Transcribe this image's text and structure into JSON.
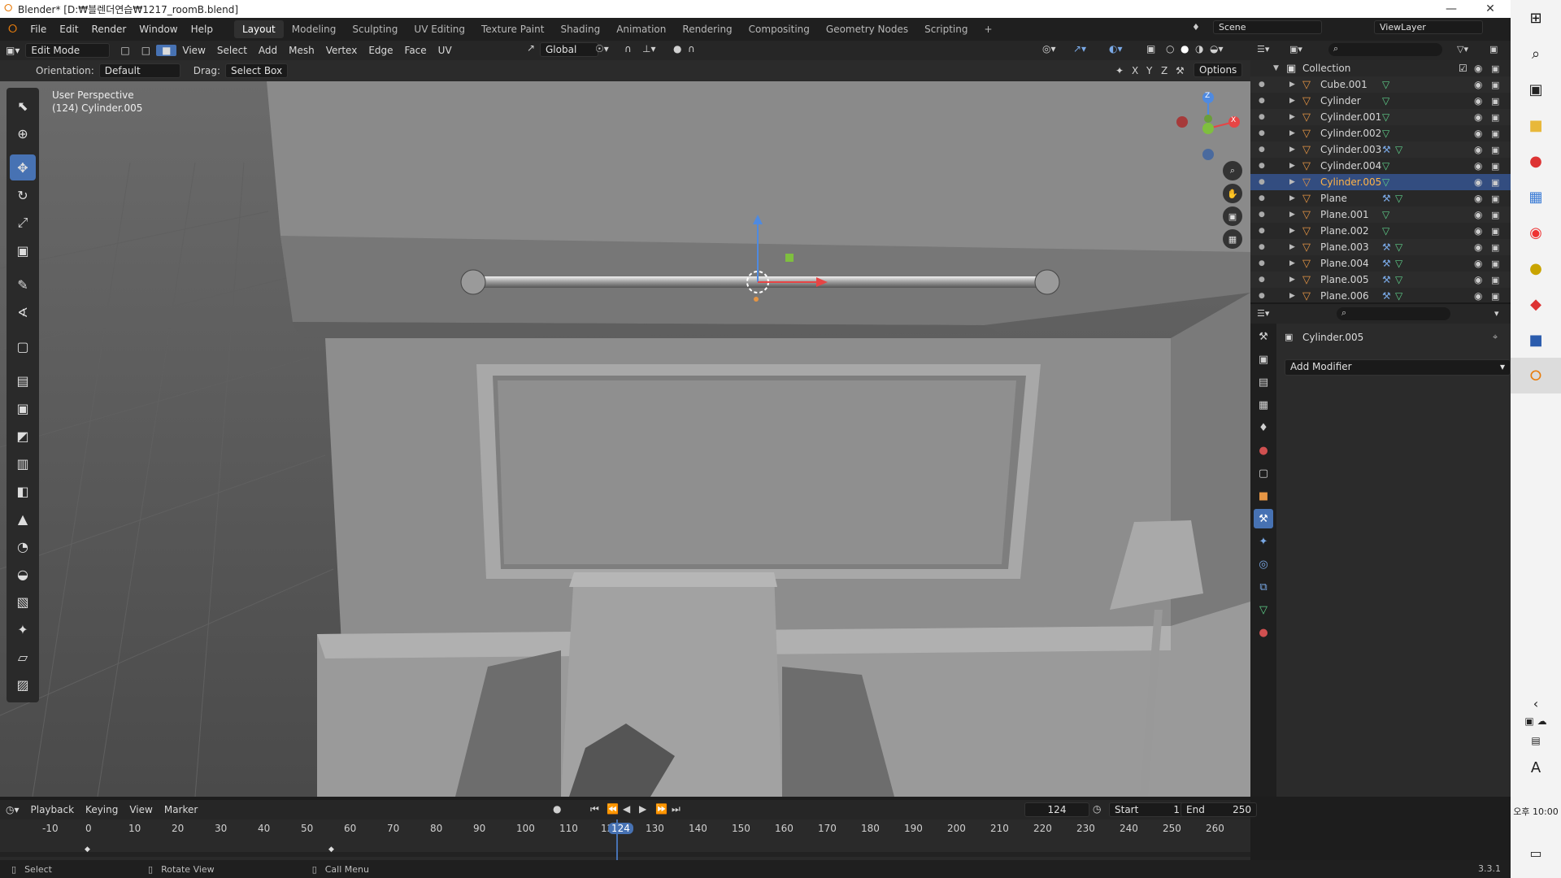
{
  "window": {
    "title": "Blender* [D:₩블렌더연습₩1217_roomB.blend]"
  },
  "menu": [
    "File",
    "Edit",
    "Render",
    "Window",
    "Help"
  ],
  "workspaces": [
    "Layout",
    "Modeling",
    "Sculpting",
    "UV Editing",
    "Texture Paint",
    "Shading",
    "Animation",
    "Rendering",
    "Compositing",
    "Geometry Nodes",
    "Scripting"
  ],
  "scene": {
    "label": "Scene",
    "view_layer": "ViewLayer"
  },
  "header": {
    "mode": "Edit Mode",
    "items": [
      "View",
      "Select",
      "Add",
      "Mesh",
      "Vertex",
      "Edge",
      "Face",
      "UV"
    ],
    "transform": "Global"
  },
  "tool_settings": {
    "orientation_label": "Orientation:",
    "orientation_value": "Default",
    "drag_label": "Drag:",
    "drag_value": "Select Box",
    "options": "Options",
    "axes": [
      "X",
      "Y",
      "Z"
    ]
  },
  "viewport": {
    "view_name": "User Perspective",
    "object_info": "(124) Cylinder.005",
    "gizmo_axes": [
      "Z",
      "X"
    ]
  },
  "outliner": {
    "collection": "Collection",
    "items": [
      {
        "name": "Cube.001",
        "modifier": false
      },
      {
        "name": "Cylinder",
        "modifier": false
      },
      {
        "name": "Cylinder.001",
        "modifier": false
      },
      {
        "name": "Cylinder.002",
        "modifier": false
      },
      {
        "name": "Cylinder.003",
        "modifier": true
      },
      {
        "name": "Cylinder.004",
        "modifier": false
      },
      {
        "name": "Cylinder.005",
        "modifier": false,
        "selected": true
      },
      {
        "name": "Plane",
        "modifier": true
      },
      {
        "name": "Plane.001",
        "modifier": false
      },
      {
        "name": "Plane.002",
        "modifier": false
      },
      {
        "name": "Plane.003",
        "modifier": true
      },
      {
        "name": "Plane.004",
        "modifier": true
      },
      {
        "name": "Plane.005",
        "modifier": true
      },
      {
        "name": "Plane.006",
        "modifier": true
      }
    ]
  },
  "properties": {
    "object_name": "Cylinder.005",
    "add_modifier": "Add Modifier"
  },
  "timeline": {
    "menus": [
      "Playback",
      "Keying",
      "View",
      "Marker"
    ],
    "current_frame": "124",
    "start_label": "Start",
    "start": "1",
    "end_label": "End",
    "end": "250",
    "ruler": [
      "-10",
      "0",
      "10",
      "20",
      "30",
      "40",
      "50",
      "60",
      "70",
      "80",
      "90",
      "100",
      "110",
      "12",
      "124",
      "130",
      "140",
      "150",
      "160",
      "170",
      "180",
      "190",
      "200",
      "210",
      "220",
      "230",
      "240",
      "250",
      "260"
    ]
  },
  "statusbar": {
    "select": "Select",
    "rotate": "Rotate View",
    "call_menu": "Call Menu",
    "version": "3.3.1"
  },
  "taskbar": {
    "time": "오후 10:00",
    "ime": "A"
  },
  "colors": {
    "accent": "#4772b3",
    "selection": "#334d80",
    "object_orange": "#e59544",
    "x_axis": "#e64545",
    "y_axis": "#7fbf3f",
    "z_axis": "#4f8ae0"
  }
}
